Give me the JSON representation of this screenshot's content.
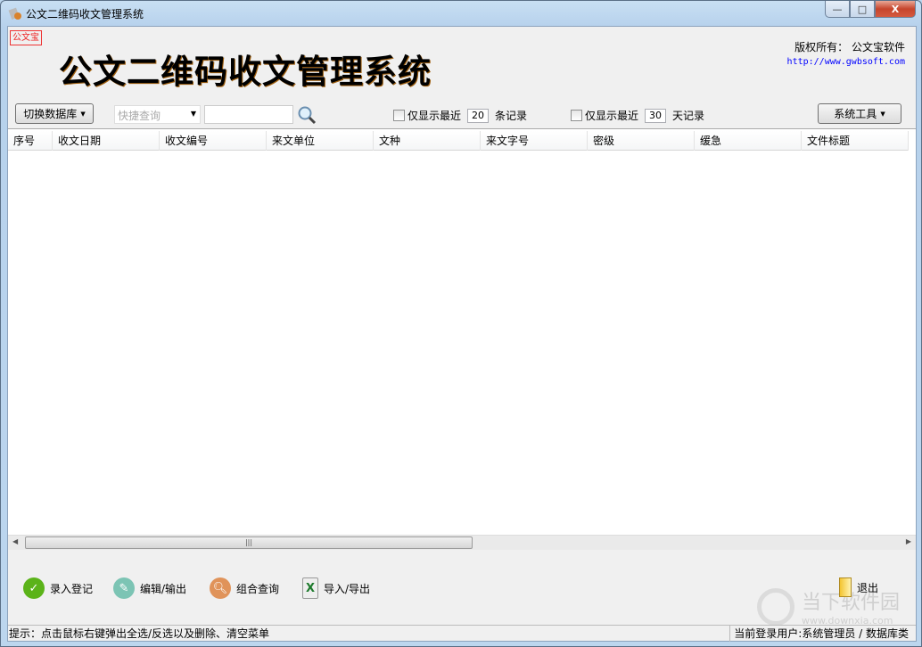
{
  "window": {
    "title": "公文二维码收文管理系统",
    "min": "—",
    "max": "□",
    "close": "X"
  },
  "header": {
    "logo_text": "公文宝",
    "app_title": "公文二维码收文管理系统",
    "copyright": "版权所有：  公文宝软件",
    "url": "http://www.gwbsoft.com"
  },
  "toolbar": {
    "switch_db": "切换数据库",
    "quick_query_placeholder": "快捷查询",
    "search_value": "",
    "filter1": {
      "label": "仅显示最近",
      "value": "20",
      "suffix": "条记录",
      "checked": false
    },
    "filter2": {
      "label": "仅显示最近",
      "value": "30",
      "suffix": "天记录",
      "checked": false
    },
    "system_tools": "系统工具"
  },
  "table": {
    "columns": [
      "序号",
      "收文日期",
      "收文编号",
      "来文单位",
      "文种",
      "来文字号",
      "密级",
      "缓急",
      "文件标题"
    ],
    "rows": []
  },
  "actions": {
    "register": "录入登记",
    "edit_output": "编辑/输出",
    "combo_query": "组合查询",
    "import_export": "导入/导出",
    "exit": "退出"
  },
  "status": {
    "hint": "提示：点击鼠标右键弹出全选/反选以及删除、清空菜单",
    "user": "当前登录用户:系统管理员 / 数据库类"
  },
  "watermark": {
    "name": "当下软件园",
    "site": "www.downxia.com"
  }
}
